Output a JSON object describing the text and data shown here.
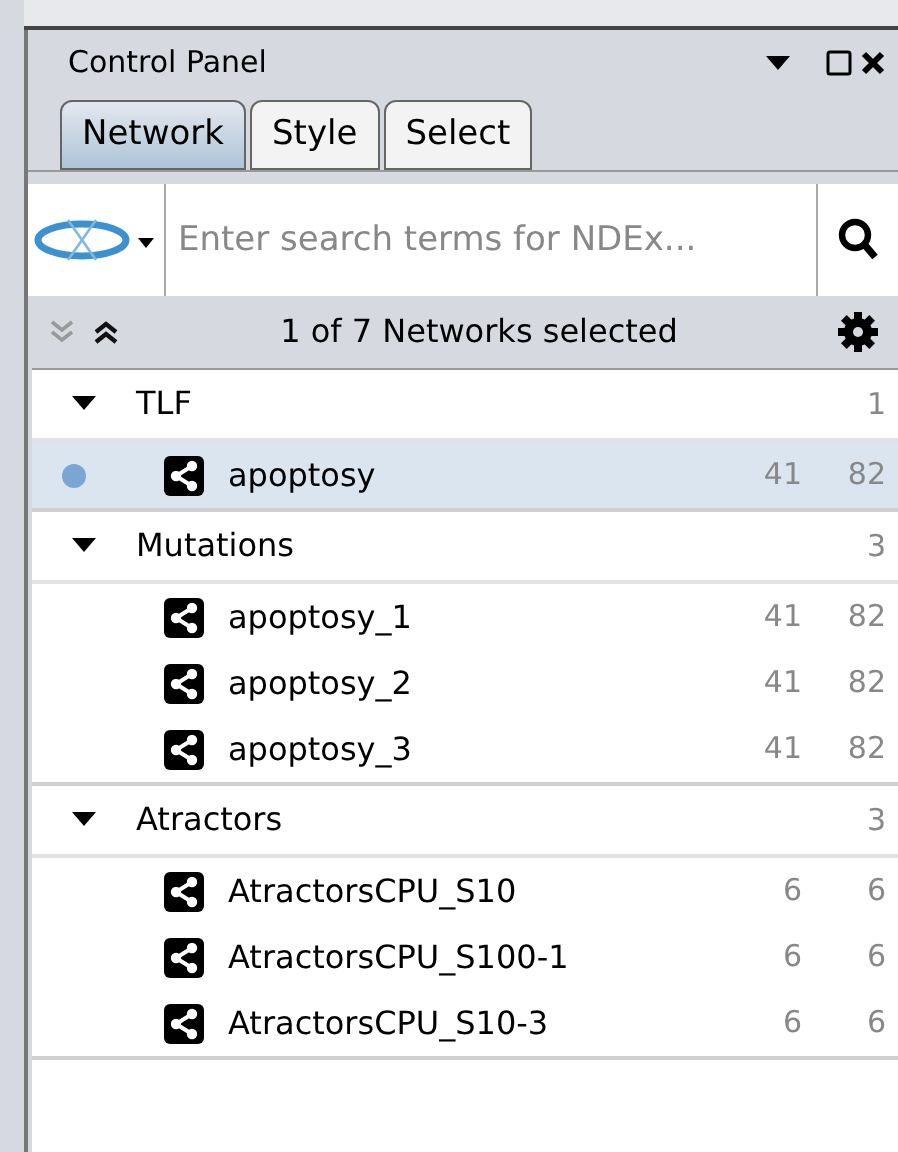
{
  "panel": {
    "title": "Control Panel"
  },
  "tabs": [
    {
      "label": "Network",
      "selected": true
    },
    {
      "label": "Style",
      "selected": false
    },
    {
      "label": "Select",
      "selected": false
    }
  ],
  "search": {
    "placeholder": "Enter search terms for NDEx..."
  },
  "status": "1 of 7 Networks selected",
  "groups": [
    {
      "name": "TLF",
      "count": "1",
      "expanded": true,
      "children": [
        {
          "name": "apoptosy",
          "nodes": "41",
          "edges": "82",
          "selected": true
        }
      ]
    },
    {
      "name": "Mutations",
      "count": "3",
      "expanded": true,
      "children": [
        {
          "name": "apoptosy_1",
          "nodes": "41",
          "edges": "82",
          "selected": false
        },
        {
          "name": "apoptosy_2",
          "nodes": "41",
          "edges": "82",
          "selected": false
        },
        {
          "name": "apoptosy_3",
          "nodes": "41",
          "edges": "82",
          "selected": false
        }
      ]
    },
    {
      "name": "Atractors",
      "count": "3",
      "expanded": true,
      "children": [
        {
          "name": "AtractorsCPU_S10",
          "nodes": "6",
          "edges": "6",
          "selected": false
        },
        {
          "name": "AtractorsCPU_S100-1",
          "nodes": "6",
          "edges": "6",
          "selected": false
        },
        {
          "name": "AtractorsCPU_S10-3",
          "nodes": "6",
          "edges": "6",
          "selected": false
        }
      ]
    }
  ]
}
